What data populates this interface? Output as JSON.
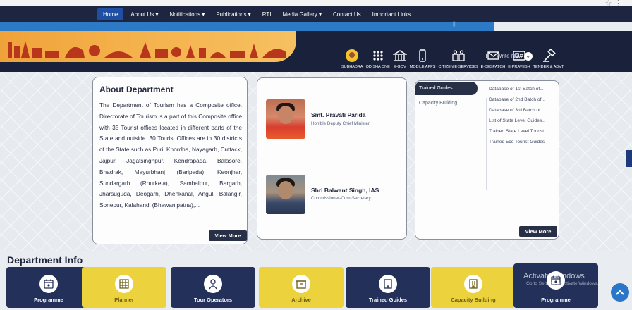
{
  "nav": {
    "items": [
      "Home",
      "About Us ▾",
      "Notifications ▾",
      "Publications ▾",
      "RTI",
      "Media Gallery ▾",
      "Contact Us",
      "Important Links"
    ]
  },
  "header": {
    "write_now": "Write Now"
  },
  "portals": [
    "SUBHADRA",
    "ODISHA ONE",
    "E-GOV",
    "MOBILE APPS",
    "CITIZEN E-SERVICES",
    "E-DESPATCH",
    "E-PRAVESH",
    "TENDER & ADVT."
  ],
  "about": {
    "title": "About Department",
    "text": "The Department of Tourism has a Composite office. Directorate of Tourism is a part of this Composite office with 35 Tourist offices located in different parts of the State and outside. 30 Tourist Offices are in 30 districts of the State such as Puri, Khordha, Nayagarh, Cuttack, Jajpur, Jagatsinghpur, Kendrapada, Balasore, Bhadrak, Mayurbhanj (Baripada), Keonjhar, Sundargarh (Rourkela), Sambalpur, Bargarh, Jharsuguda, Deogarh, Dhenkanal, Angul, Balangir, Sonepur, Kalahandi (Bhawanipatna),...",
    "view_more": "View More"
  },
  "officials": [
    {
      "name": "Smt. Pravati Parida",
      "designation": "Hon'ble Deputy Chief Minister"
    },
    {
      "name": "Shri Balwant Singh, IAS",
      "designation": "Commissioner-Cum-Secretary"
    }
  ],
  "guides": {
    "tabs": [
      "Trained Guides",
      "Capacity Building"
    ],
    "items": [
      "Database of 1st Batch of...",
      "Database of 2nd Batch of...",
      "Database of 3rd Batch of...",
      "List of State Level Guides...",
      "Trained State Level Tourist...",
      "Trained Eco Tourist Guides"
    ],
    "view_more": "View More"
  },
  "dept_info": {
    "title": "Department Info",
    "tiles": [
      {
        "label": "Programme",
        "style": "dark",
        "icon": "calendar-icon"
      },
      {
        "label": "Planner",
        "style": "yellow",
        "icon": "planner-icon"
      },
      {
        "label": "Tour Operators",
        "style": "dark",
        "icon": "tour-operator-icon"
      },
      {
        "label": "Archive",
        "style": "yellow",
        "icon": "archive-icon"
      },
      {
        "label": "Trained Guides",
        "style": "dark",
        "icon": "building-icon"
      },
      {
        "label": "Capacity Building",
        "style": "yellow",
        "icon": "building-icon"
      },
      {
        "label": "Programme",
        "style": "dark",
        "icon": "calendar-icon"
      }
    ]
  },
  "overlay": {
    "activate_title": "Activate Windows",
    "activate_sub": "Go to Settings to activate Windows."
  },
  "colors": {
    "nav_bg": "#1d2540",
    "accent_blue": "#2c79c6",
    "tile_dark": "#22305a",
    "tile_yellow": "#ecd23c",
    "banner_orange": "#f0a23a"
  }
}
